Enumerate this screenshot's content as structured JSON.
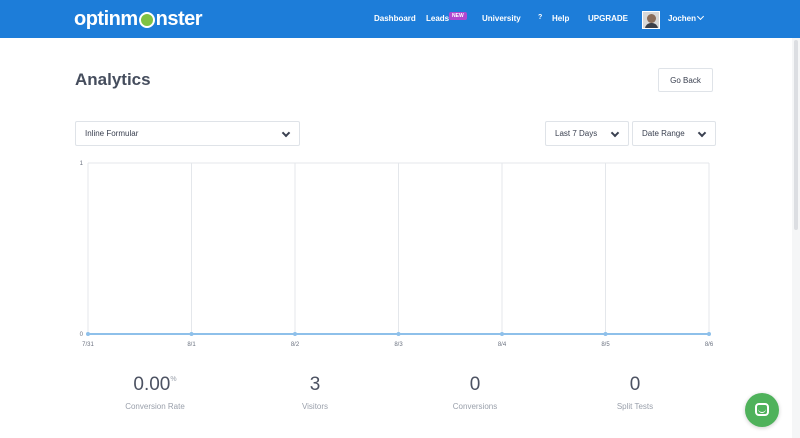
{
  "header": {
    "logo_text_before": "optinm",
    "logo_text_after": "nster",
    "nav": {
      "dashboard": "Dashboard",
      "leads": "Leads",
      "leads_badge": "NEW",
      "university": "University",
      "help_icon": "?",
      "help": "Help",
      "upgrade": "UPGRADE",
      "user": "Jochen"
    }
  },
  "page": {
    "title": "Analytics",
    "go_back": "Go Back"
  },
  "filters": {
    "campaign": "Inline Formular",
    "period": "Last 7 Days",
    "date_range": "Date Range"
  },
  "chart_data": {
    "type": "line",
    "x": [
      "7/31",
      "8/1",
      "8/2",
      "8/3",
      "8/4",
      "8/5",
      "8/6"
    ],
    "series": [
      {
        "values": [
          0,
          0,
          0,
          0,
          0,
          0,
          0
        ]
      }
    ],
    "y_ticks": [
      "0",
      "1"
    ],
    "ylim": [
      0,
      1
    ],
    "grid": true,
    "line_color": "#8ec0ea"
  },
  "stats": [
    {
      "value": "0.00",
      "unit": "%",
      "label": "Conversion Rate"
    },
    {
      "value": "3",
      "unit": "",
      "label": "Visitors"
    },
    {
      "value": "0",
      "unit": "",
      "label": "Conversions"
    },
    {
      "value": "0",
      "unit": "",
      "label": "Split Tests"
    }
  ],
  "colors": {
    "header_bg": "#1d7dd9",
    "new_badge": "#b048d0",
    "chat_button": "#4fb25b"
  }
}
